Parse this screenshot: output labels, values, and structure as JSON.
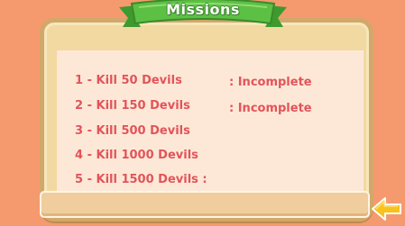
{
  "header": {
    "title": "Missions"
  },
  "missions": [
    {
      "label": "1 - Kill 50 Devils",
      "status": ": Incomplete"
    },
    {
      "label": "2 - Kill 150 Devils",
      "status": ": Incomplete"
    },
    {
      "label": "3 - Kill 500 Devils",
      "status": ""
    },
    {
      "label": "4 - Kill 1000 Devils",
      "status": ""
    },
    {
      "label": "5 - Kill 1500 Devils :",
      "status": ""
    }
  ],
  "colors": {
    "background": "#f59a6e",
    "board": "#f2d9a1",
    "paper": "#fde8d7",
    "mission_text": "#e2545a",
    "ribbon": "#5cc044",
    "arrow": "#f7c21a"
  },
  "icons": {
    "back": "back-arrow-icon"
  }
}
